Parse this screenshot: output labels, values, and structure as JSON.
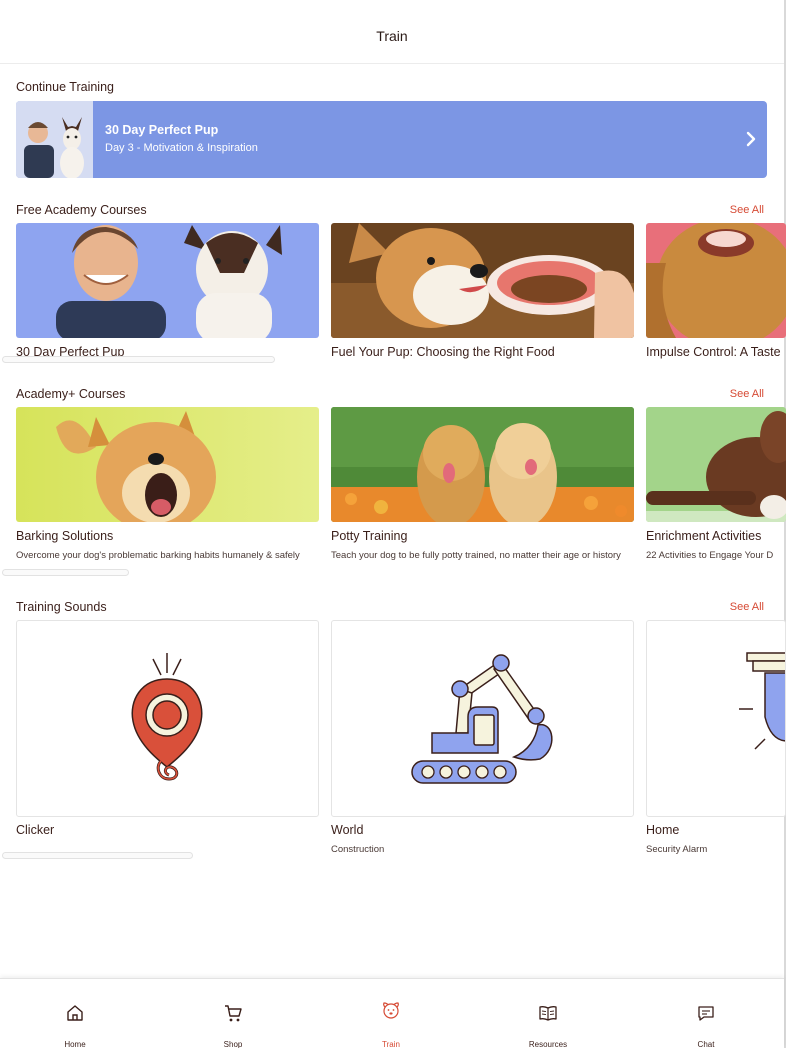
{
  "header": {
    "title": "Train"
  },
  "continue_training": {
    "section_title": "Continue Training",
    "course_title": "30 Day Perfect Pup",
    "course_sub": "Day 3 - Motivation & Inspiration",
    "chevron_icon": "chevron-right-icon"
  },
  "free_courses": {
    "section_title": "Free Academy Courses",
    "see_all": "See All",
    "items": [
      {
        "label": "30 Day Perfect Pup"
      },
      {
        "label": "Fuel Your Pup: Choosing the Right Food"
      },
      {
        "label": "Impulse Control: A Taste"
      }
    ]
  },
  "plus_courses": {
    "section_title": "Academy+ Courses",
    "see_all": "See All",
    "items": [
      {
        "label": "Barking Solutions",
        "desc": "Overcome your dog's problematic barking habits humanely & safely"
      },
      {
        "label": "Potty Training",
        "desc": "Teach your dog to be fully potty trained, no matter their age or history"
      },
      {
        "label": "Enrichment Activities",
        "desc": "22 Activities to Engage Your D"
      }
    ]
  },
  "training_sounds": {
    "section_title": "Training Sounds",
    "see_all": "See All",
    "items": [
      {
        "label": "Clicker",
        "sub": ""
      },
      {
        "label": "World",
        "sub": "Construction"
      },
      {
        "label": "Home",
        "sub": "Security Alarm"
      }
    ]
  },
  "tabbar": {
    "items": [
      {
        "label": "Home",
        "icon": "home-icon"
      },
      {
        "label": "Shop",
        "icon": "cart-icon"
      },
      {
        "label": "Train",
        "icon": "dog-face-icon"
      },
      {
        "label": "Resources",
        "icon": "book-icon"
      },
      {
        "label": "Chat",
        "icon": "chat-icon"
      }
    ],
    "active": "Train"
  },
  "colors": {
    "accent": "#d64a34",
    "banner": "#7c96e4",
    "illustration_blue": "#8fa3ee",
    "illustration_cream": "#f6f3dd",
    "clicker_red": "#d9503a"
  }
}
